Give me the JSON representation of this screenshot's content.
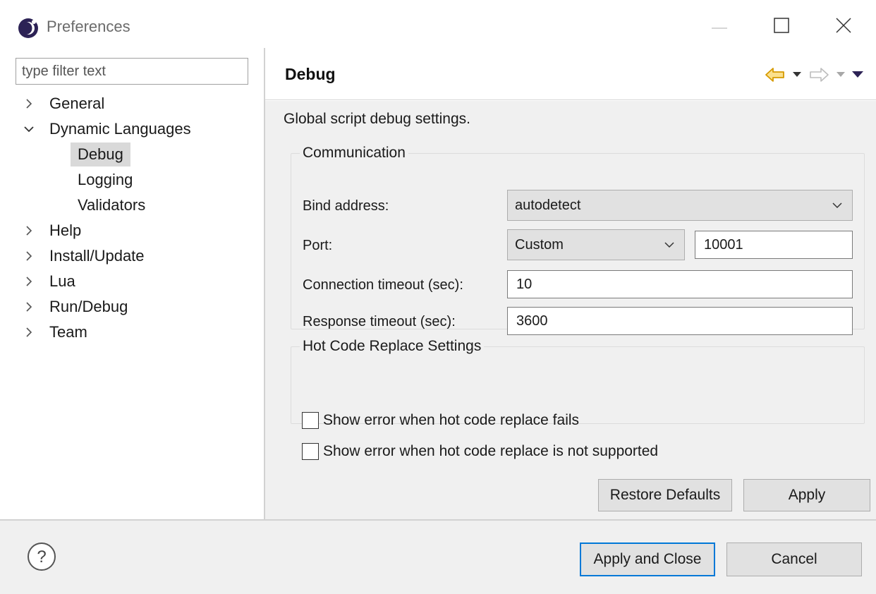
{
  "window": {
    "title": "Preferences",
    "icons": {
      "app": "eclipse-icon",
      "minimize": "minimize-icon",
      "maximize": "maximize-icon",
      "close": "close-icon"
    }
  },
  "sidebar": {
    "filter_placeholder": "type filter text",
    "items": [
      {
        "label": "General",
        "expanded": false,
        "has_children": true
      },
      {
        "label": "Dynamic Languages",
        "expanded": true,
        "has_children": true
      },
      {
        "label": "Debug",
        "selected": true,
        "child": true
      },
      {
        "label": "Logging",
        "child": true
      },
      {
        "label": "Validators",
        "child": true
      },
      {
        "label": "Help",
        "expanded": false,
        "has_children": true
      },
      {
        "label": "Install/Update",
        "expanded": false,
        "has_children": true
      },
      {
        "label": "Lua",
        "expanded": false,
        "has_children": true
      },
      {
        "label": "Run/Debug",
        "expanded": false,
        "has_children": true
      },
      {
        "label": "Team",
        "expanded": false,
        "has_children": true
      }
    ]
  },
  "page": {
    "title": "Debug",
    "description": "Global script debug settings.",
    "nav_icons": [
      "back-arrow-icon",
      "dropdown-icon",
      "forward-arrow-icon",
      "dropdown-icon",
      "view-menu-icon"
    ],
    "communication": {
      "legend": "Communication",
      "bind_address_label": "Bind address:",
      "bind_address_value": "autodetect",
      "port_label": "Port:",
      "port_mode_value": "Custom",
      "port_value": "10001",
      "connection_timeout_label": "Connection timeout (sec):",
      "connection_timeout_value": "10",
      "response_timeout_label": "Response timeout (sec):",
      "response_timeout_value": "3600"
    },
    "hot_code_replace": {
      "legend": "Hot Code Replace Settings",
      "show_error_fails_label": "Show error when hot code replace fails",
      "show_error_fails_checked": false,
      "show_error_unsupported_label": "Show error when hot code replace is not supported",
      "show_error_unsupported_checked": false
    },
    "restore_defaults_label": "Restore Defaults",
    "apply_label": "Apply"
  },
  "footer": {
    "help_icon": "help-icon",
    "apply_close_label": "Apply and Close",
    "cancel_label": "Cancel"
  },
  "colors": {
    "accent": "#0078d7",
    "back_arrow": "#e8a317",
    "selection": "#d9d9d9",
    "panel_bg": "#f0f0f0"
  }
}
